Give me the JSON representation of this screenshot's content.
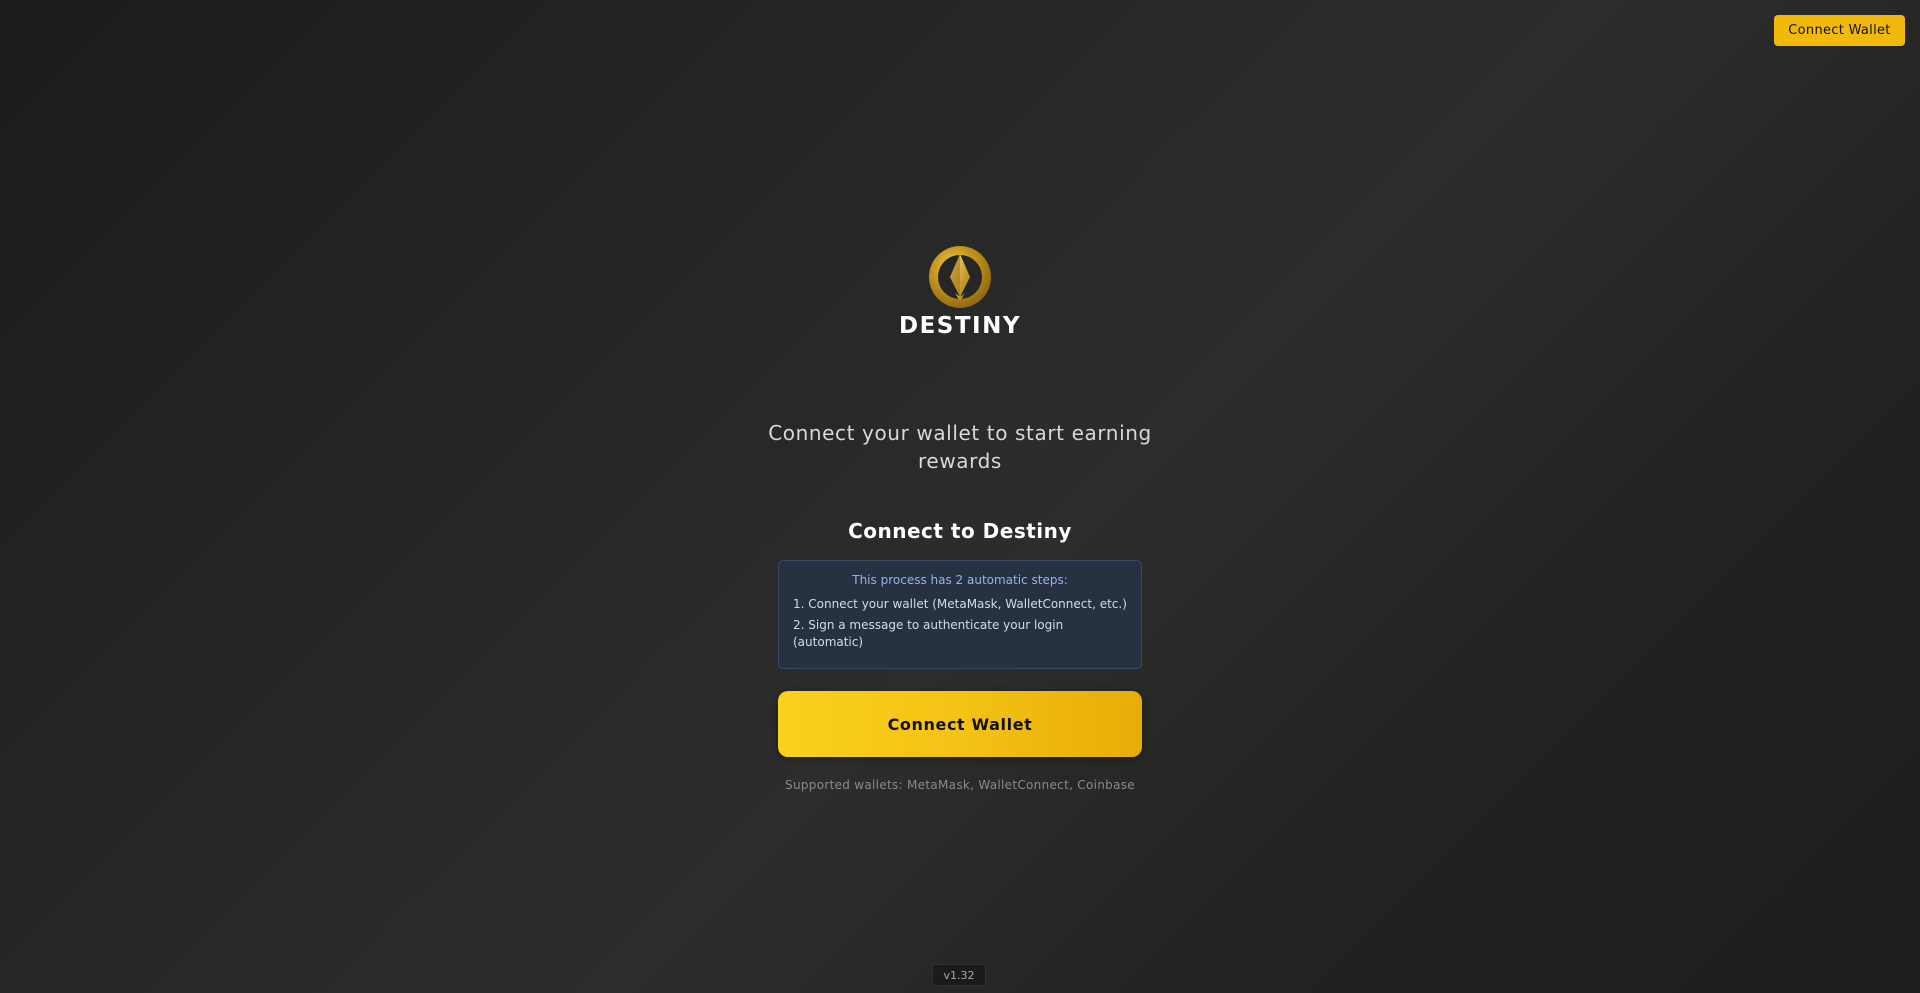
{
  "header": {
    "connect_button_label": "Connect Wallet"
  },
  "brand": {
    "name": "DESTINY",
    "logo_icon": "destiny-gold-emblem-icon",
    "accent_color": "#f0b90b"
  },
  "hero": {
    "tagline": "Connect your wallet to start earning rewards"
  },
  "connect_panel": {
    "title": "Connect to Destiny",
    "info": {
      "heading": "This process has 2 automatic steps:",
      "steps": [
        "1. Connect your wallet (MetaMask, WalletConnect, etc.)",
        "2. Sign a message to authenticate your login (automatic)"
      ]
    },
    "connect_button_label": "Connect Wallet",
    "supported_wallets": "Supported wallets: MetaMask, WalletConnect, Coinbase"
  },
  "footer": {
    "version": "v1.32"
  }
}
